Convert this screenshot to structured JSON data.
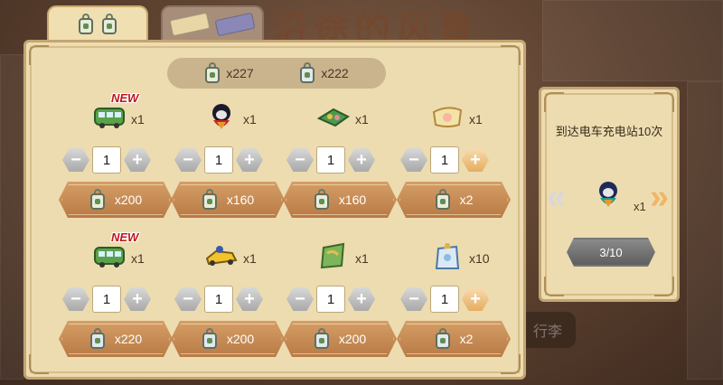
{
  "background": {
    "title_text": "沿途的风景",
    "sign_text": "行李"
  },
  "tabs": [
    {
      "id": "lanterns",
      "selected": true,
      "icons": [
        "lantern-token",
        "lantern-token"
      ]
    },
    {
      "id": "tickets",
      "selected": false,
      "icons": [
        "tan-ticket",
        "purple-ticket"
      ]
    }
  ],
  "currency": [
    {
      "icon": "green-lantern-token",
      "amount": "x227"
    },
    {
      "icon": "blue-lantern-token",
      "amount": "x222"
    }
  ],
  "shop_items": [
    {
      "icon": "green-tram",
      "qty": "x1",
      "new_badge": "NEW",
      "stepper_value": "1",
      "plus_active": false,
      "price": "x200",
      "price_icon": "green-lantern-token"
    },
    {
      "icon": "penguin-costume",
      "qty": "x1",
      "new_badge": "",
      "stepper_value": "1",
      "plus_active": false,
      "price": "x160",
      "price_icon": "green-lantern-token"
    },
    {
      "icon": "green-plant-tray",
      "qty": "x1",
      "new_badge": "",
      "stepper_value": "1",
      "plus_active": false,
      "price": "x160",
      "price_icon": "green-lantern-token"
    },
    {
      "icon": "cream-cushion",
      "qty": "x1",
      "new_badge": "",
      "stepper_value": "1",
      "plus_active": true,
      "price": "x2",
      "price_icon": "green-lantern-token"
    },
    {
      "icon": "green-tram",
      "qty": "x1",
      "new_badge": "NEW",
      "stepper_value": "1",
      "plus_active": false,
      "price": "x220",
      "price_icon": "blue-lantern-token"
    },
    {
      "icon": "yellow-kart",
      "qty": "x1",
      "new_badge": "",
      "stepper_value": "1",
      "plus_active": false,
      "price": "x200",
      "price_icon": "blue-lantern-token"
    },
    {
      "icon": "green-map-scroll",
      "qty": "x1",
      "new_badge": "",
      "stepper_value": "1",
      "plus_active": false,
      "price": "x200",
      "price_icon": "blue-lantern-token"
    },
    {
      "icon": "blue-gift-bag",
      "qty": "x10",
      "new_badge": "",
      "stepper_value": "1",
      "plus_active": true,
      "price": "x2",
      "price_icon": "blue-lantern-token"
    }
  ],
  "side_panel": {
    "title": "到达电车充电站10次",
    "reward_icon": "penguin-costume",
    "reward_qty": "x1",
    "progress_text": "3/10",
    "progress": {
      "current": 3,
      "total": 10
    }
  },
  "colors": {
    "panel_bg": "#ecdcb0",
    "panel_border": "#c4a572",
    "buy_button": "#c88a50",
    "stepper_active": "#e6ad62",
    "stepper_inactive": "#a9a9a9",
    "new_badge": "#c0141c"
  }
}
